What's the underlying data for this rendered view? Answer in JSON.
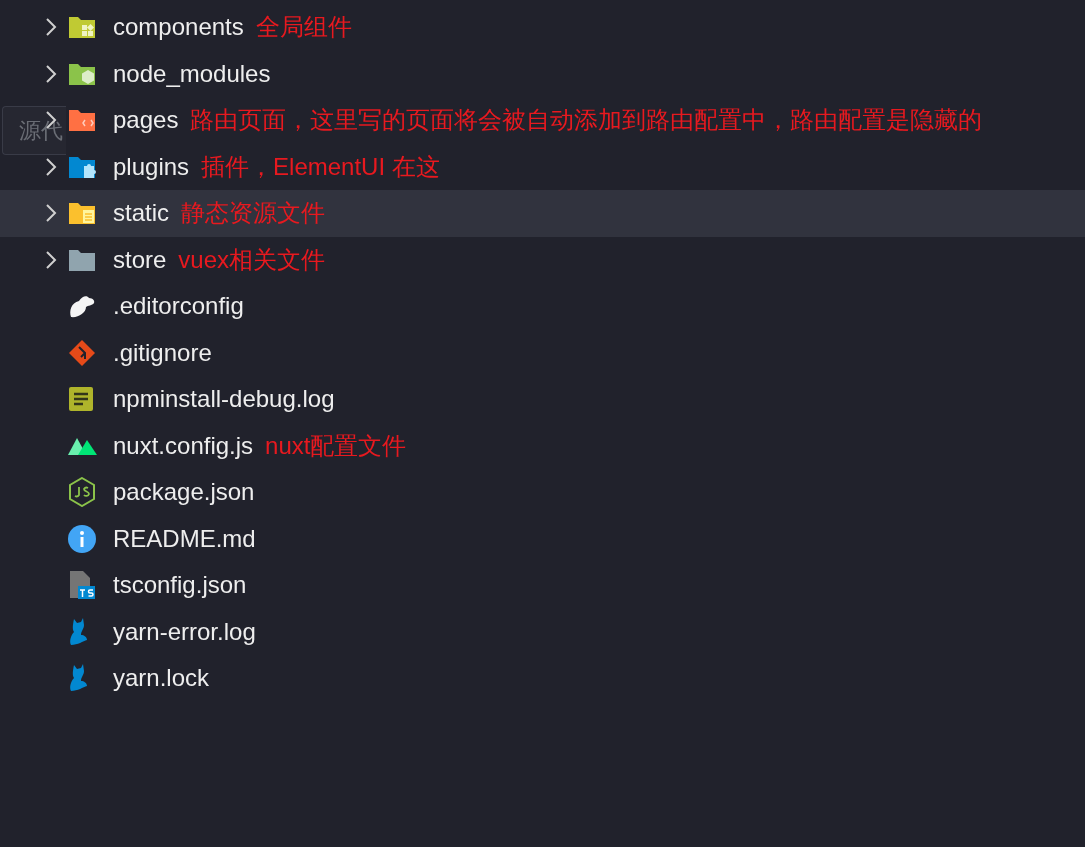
{
  "tooltip": {
    "text": "源代"
  },
  "explorer": {
    "items": [
      {
        "kind": "folder",
        "name": "components",
        "expanded": false,
        "selected": false,
        "note": "全局组件"
      },
      {
        "kind": "folder",
        "name": "node_modules",
        "expanded": false,
        "selected": false
      },
      {
        "kind": "folder",
        "name": "pages",
        "expanded": false,
        "selected": false,
        "note": "路由页面，这里写的页面将会被自动添加到路由配置中，路由配置是隐藏的"
      },
      {
        "kind": "folder",
        "name": "plugins",
        "expanded": false,
        "selected": false,
        "note": "插件，ElementUI 在这"
      },
      {
        "kind": "folder",
        "name": "static",
        "expanded": false,
        "selected": true,
        "note": "静态资源文件"
      },
      {
        "kind": "folder",
        "name": "store",
        "expanded": false,
        "selected": false,
        "note": "vuex相关文件"
      },
      {
        "kind": "file",
        "name": ".editorconfig",
        "selected": false
      },
      {
        "kind": "file",
        "name": ".gitignore",
        "selected": false
      },
      {
        "kind": "file",
        "name": "npminstall-debug.log",
        "selected": false
      },
      {
        "kind": "file",
        "name": "nuxt.config.js",
        "selected": false,
        "note": "nuxt配置文件"
      },
      {
        "kind": "file",
        "name": "package.json",
        "selected": false
      },
      {
        "kind": "file",
        "name": "README.md",
        "selected": false
      },
      {
        "kind": "file",
        "name": "tsconfig.json",
        "selected": false
      },
      {
        "kind": "file",
        "name": "yarn-error.log",
        "selected": false
      },
      {
        "kind": "file",
        "name": "yarn.lock",
        "selected": false
      }
    ]
  }
}
